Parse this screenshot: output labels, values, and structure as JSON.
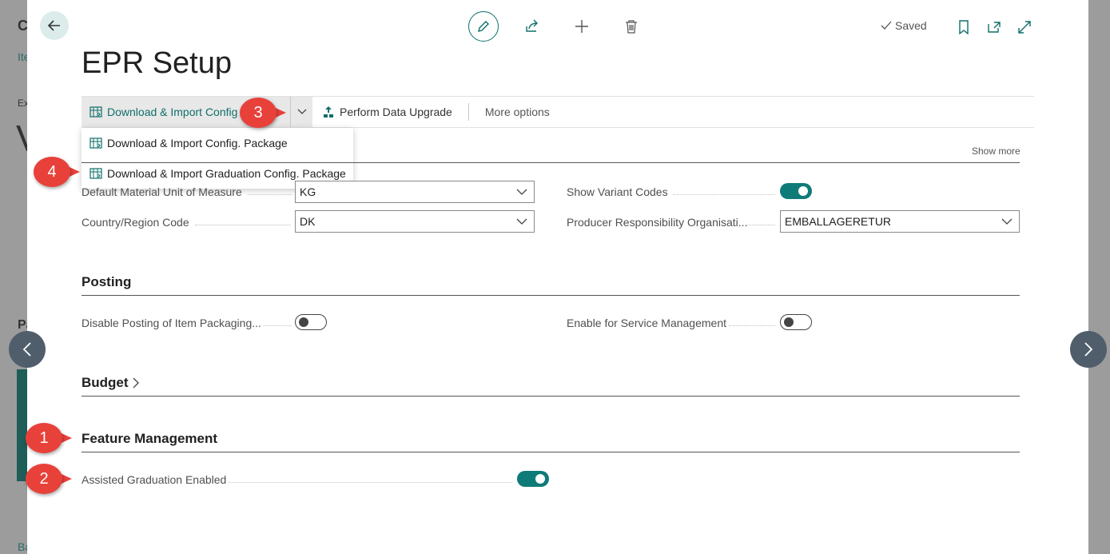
{
  "background": {
    "title_initial": "C",
    "link_fragment": "Ite",
    "label_fragment": "Ex",
    "big_letter": "V",
    "section_fragment": "Pa",
    "bottom_fragment": "Ba"
  },
  "header": {
    "saved_label": "Saved",
    "page_title": "EPR Setup"
  },
  "action_bar": {
    "primary_label": "Download & Import Config",
    "perform_upgrade_label": "Perform Data Upgrade",
    "more_options_label": "More options"
  },
  "dropdown": {
    "items": [
      {
        "label": "Download & Import Config. Package"
      },
      {
        "label": "Download & Import Graduation Config. Package"
      }
    ]
  },
  "general": {
    "show_more_label": "Show more",
    "fields": {
      "default_uom": {
        "label": "Default Material Unit of Measure",
        "value": "KG"
      },
      "country_code": {
        "label": "Country/Region Code",
        "value": "DK"
      },
      "show_variant_codes": {
        "label": "Show Variant Codes",
        "value": true
      },
      "producer_org": {
        "label": "Producer Responsibility Organisati...",
        "value": "EMBALLAGERETUR"
      }
    }
  },
  "posting": {
    "title": "Posting",
    "disable_posting": {
      "label": "Disable Posting of Item Packaging...",
      "value": false
    },
    "service_mgmt": {
      "label": "Enable for Service Management",
      "value": false
    }
  },
  "budget": {
    "title": "Budget"
  },
  "feature_management": {
    "title": "Feature Management",
    "assisted_graduation": {
      "label": "Assisted Graduation Enabled",
      "value": true
    }
  },
  "callouts": [
    "1",
    "2",
    "3",
    "4"
  ],
  "colors": {
    "accent": "#0f6f6a",
    "toggle_on": "#0f7b78",
    "callout": "#e8413a",
    "nav_button": "#505e6c"
  }
}
